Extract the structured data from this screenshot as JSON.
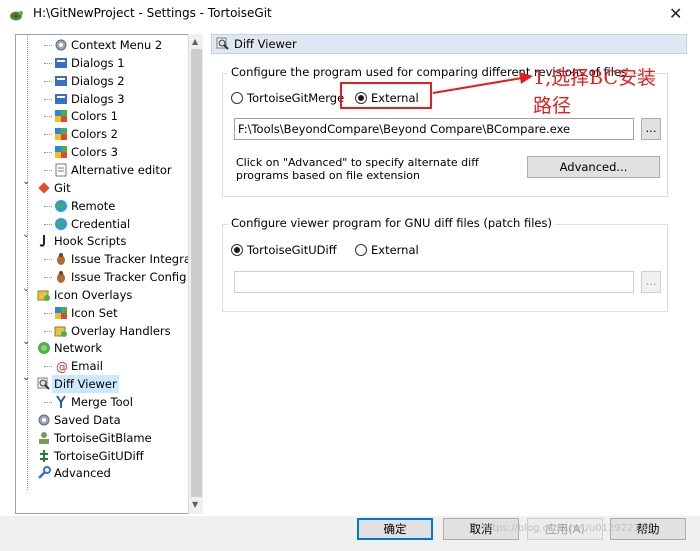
{
  "window": {
    "title": "H:\\GitNewProject - Settings - TortoiseGit"
  },
  "tree": {
    "items": [
      {
        "label": "Context Menu 2",
        "icon": "gear-icon"
      },
      {
        "label": "Dialogs 1",
        "icon": "dialog-icon"
      },
      {
        "label": "Dialogs 2",
        "icon": "dialog-icon"
      },
      {
        "label": "Dialogs 3",
        "icon": "dialog-icon"
      },
      {
        "label": "Colors 1",
        "icon": "palette-icon"
      },
      {
        "label": "Colors 2",
        "icon": "palette-icon"
      },
      {
        "label": "Colors 3",
        "icon": "palette-icon"
      },
      {
        "label": "Alternative editor",
        "icon": "editor-icon"
      },
      {
        "label": "Git",
        "icon": "git-icon"
      },
      {
        "label": "Remote",
        "icon": "globe-icon"
      },
      {
        "label": "Credential",
        "icon": "globe-icon"
      },
      {
        "label": "Hook Scripts",
        "icon": "hook-icon"
      },
      {
        "label": "Issue Tracker Integrati",
        "icon": "bug-icon"
      },
      {
        "label": "Issue Tracker Config",
        "icon": "bug-icon"
      },
      {
        "label": "Icon Overlays",
        "icon": "overlay-icon"
      },
      {
        "label": "Icon Set",
        "icon": "palette-icon"
      },
      {
        "label": "Overlay Handlers",
        "icon": "overlay-icon"
      },
      {
        "label": "Network",
        "icon": "network-icon"
      },
      {
        "label": "Email",
        "icon": "email-icon"
      },
      {
        "label": "Diff Viewer",
        "icon": "magnifier-icon"
      },
      {
        "label": "Merge Tool",
        "icon": "merge-icon"
      },
      {
        "label": "Saved Data",
        "icon": "gear-icon"
      },
      {
        "label": "TortoiseGitBlame",
        "icon": "blame-icon"
      },
      {
        "label": "TortoiseGitUDiff",
        "icon": "udiff-icon"
      },
      {
        "label": "Advanced",
        "icon": "wrench-icon"
      }
    ]
  },
  "panel": {
    "title": "Diff Viewer",
    "diff_group": {
      "caption": "Configure the program used for comparing different revisions of files",
      "option_internal": "TortoiseGitMerge",
      "option_external": "External",
      "selected": "external",
      "path_value": "F:\\Tools\\BeyondCompare\\Beyond Compare\\BCompare.exe",
      "browse_label": "...",
      "advanced_desc_line1": "Click on \"Advanced\" to specify alternate diff",
      "advanced_desc_line2": "programs based on file extension",
      "advanced_label": "Advanced..."
    },
    "patch_group": {
      "caption": "Configure viewer program for GNU diff files (patch files)",
      "option_internal": "TortoiseGitUDiff",
      "option_external": "External",
      "selected": "internal",
      "path_value": "",
      "browse_label": "..."
    }
  },
  "annotation": {
    "line1": "1,选择BC安装",
    "line2": "路径"
  },
  "buttons": {
    "ok": "确定",
    "cancel": "取消",
    "apply": "应用(A)",
    "help": "帮助"
  },
  "watermark": "https://blog.csdn.net/u012922189",
  "colors": {
    "accent": "#0078d7",
    "annotation": "#e0201e",
    "selection": "#cce8ff"
  }
}
